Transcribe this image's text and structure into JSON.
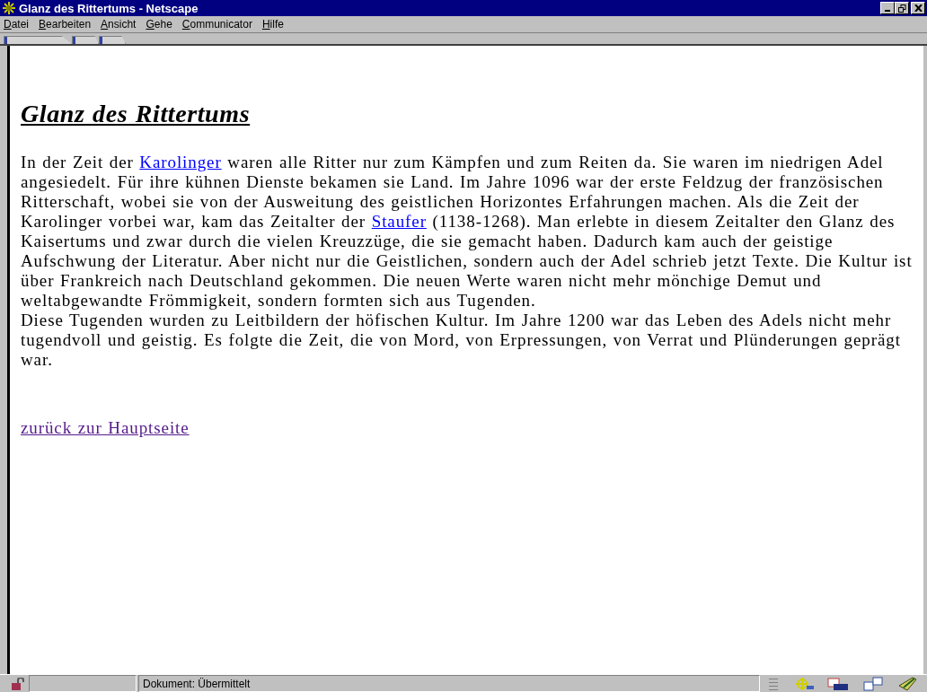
{
  "window": {
    "title": "Glanz des Rittertums - Netscape"
  },
  "menu": [
    "Datei",
    "Bearbeiten",
    "Ansicht",
    "Gehe",
    "Communicator",
    "Hilfe"
  ],
  "page": {
    "heading": "Glanz des Rittertums",
    "paragraphs": [
      [
        {
          "kind": "text",
          "text": "In der Zeit der "
        },
        {
          "kind": "link",
          "text": "Karolinger",
          "visited": false
        },
        {
          "kind": "text",
          "text": " waren alle Ritter nur zum Kämpfen und zum Reiten da. Sie waren im niedrigen Adel angesiedelt. Für ihre kühnen Dienste bekamen sie Land. Im Jahre 1096 war der erste Feldzug der französischen Ritterschaft, wobei sie von der Ausweitung des geistlichen Horizontes Erfahrungen machen. Als die Zeit der Karolinger vorbei war, kam das Zeitalter der "
        },
        {
          "kind": "link",
          "text": "Staufer",
          "visited": false
        },
        {
          "kind": "text",
          "text": " (1138-1268). Man erlebte in diesem Zeitalter den Glanz des Kaisertums und zwar durch die vielen Kreuzzüge, die sie gemacht haben. Dadurch kam auch der geistige Aufschwung der Literatur. Aber nicht nur die Geistlichen, sondern auch der Adel schrieb jetzt Texte. Die Kultur ist über Frankreich nach Deutschland gekommen. Die neuen Werte waren nicht mehr mönchige Demut und weltabgewandte Frömmigkeit, sondern formten sich aus Tugenden."
        }
      ],
      [
        {
          "kind": "text",
          "text": "Diese Tugenden wurden zu Leitbildern der höfischen Kultur. Im Jahre 1200 war das Leben des Adels nicht mehr tugendvoll und geistig. Es folgte die Zeit, die von Mord, von Erpressungen, von Verrat und Plünderungen geprägt war."
        }
      ]
    ],
    "back_link": {
      "text": "zurück zur Hauptseite",
      "visited": true
    }
  },
  "status_bar": {
    "text": "Dokument: Übermittelt"
  }
}
